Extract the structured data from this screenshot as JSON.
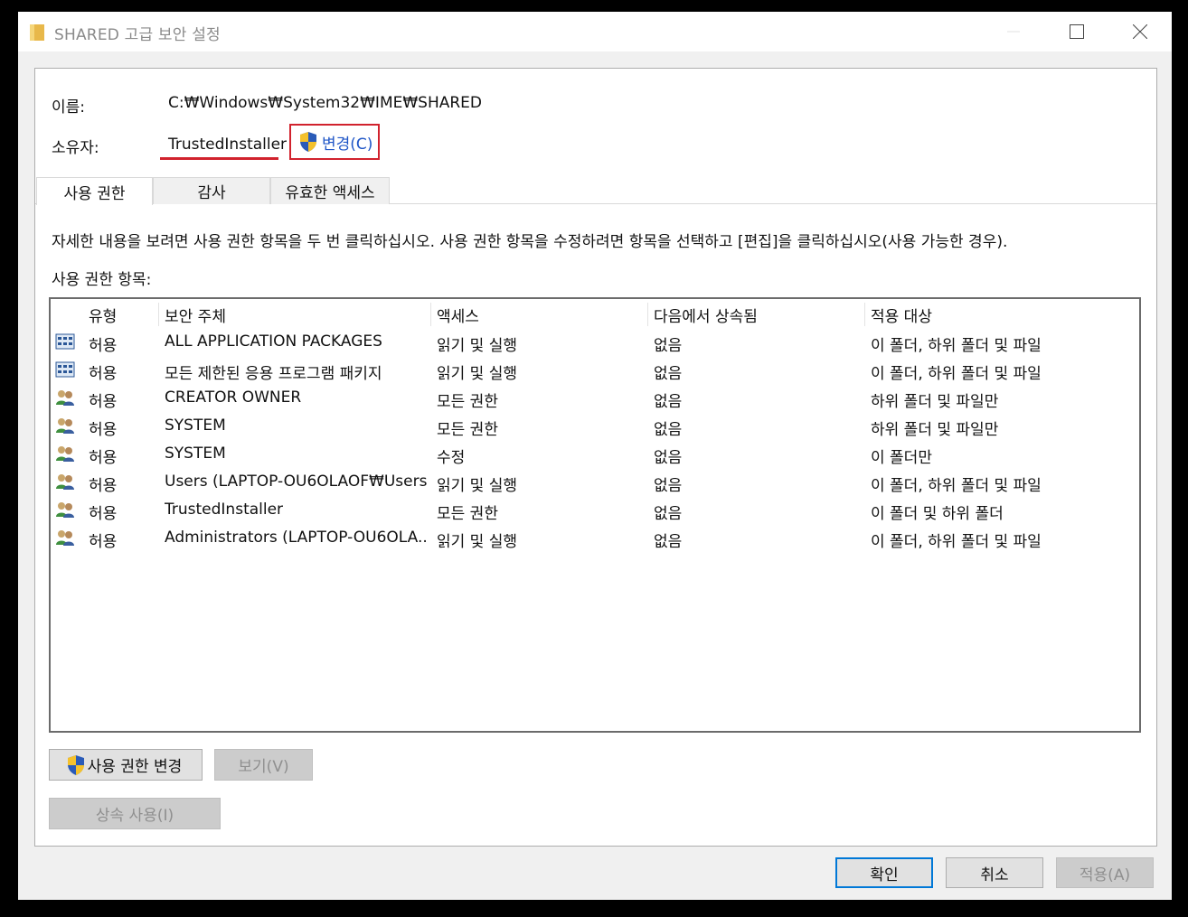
{
  "window": {
    "title": "SHARED 고급 보안 설정"
  },
  "info": {
    "name_label": "이름:",
    "name_value": "C:₩Windows₩System32₩IME₩SHARED",
    "owner_label": "소유자:",
    "owner_value": "TrustedInstaller",
    "change_label": "변경(C)"
  },
  "tabs": [
    {
      "label": "사용 권한",
      "active": true
    },
    {
      "label": "감사",
      "active": false
    },
    {
      "label": "유효한 액세스",
      "active": false
    }
  ],
  "description": "자세한 내용을 보려면 사용 권한 항목을 두 번 클릭하십시오. 사용 권한 항목을 수정하려면 항목을 선택하고 [편집]을 클릭하십시오(사용 가능한 경우).",
  "entries_label": "사용 권한 항목:",
  "table": {
    "columns": [
      "유형",
      "보안 주체",
      "액세스",
      "다음에서 상속됨",
      "적용 대상"
    ],
    "rows": [
      {
        "icon": "package-icon",
        "type": "허용",
        "principal": "ALL APPLICATION PACKAGES",
        "access": "읽기 및 실행",
        "inherited": "없음",
        "applies": "이 폴더, 하위 폴더 및 파일"
      },
      {
        "icon": "package-icon",
        "type": "허용",
        "principal": "모든 제한된 응용 프로그램 패키지",
        "access": "읽기 및 실행",
        "inherited": "없음",
        "applies": "이 폴더, 하위 폴더 및 파일"
      },
      {
        "icon": "users-icon",
        "type": "허용",
        "principal": "CREATOR OWNER",
        "access": "모든 권한",
        "inherited": "없음",
        "applies": "하위 폴더 및 파일만"
      },
      {
        "icon": "users-icon",
        "type": "허용",
        "principal": "SYSTEM",
        "access": "모든 권한",
        "inherited": "없음",
        "applies": "하위 폴더 및 파일만"
      },
      {
        "icon": "users-icon",
        "type": "허용",
        "principal": "SYSTEM",
        "access": "수정",
        "inherited": "없음",
        "applies": "이 폴더만"
      },
      {
        "icon": "users-icon",
        "type": "허용",
        "principal": "Users (LAPTOP-OU6OLAOF₩Users)",
        "access": "읽기 및 실행",
        "inherited": "없음",
        "applies": "이 폴더, 하위 폴더 및 파일"
      },
      {
        "icon": "users-icon",
        "type": "허용",
        "principal": "TrustedInstaller",
        "access": "모든 권한",
        "inherited": "없음",
        "applies": "이 폴더 및 하위 폴더"
      },
      {
        "icon": "users-icon",
        "type": "허용",
        "principal": "Administrators (LAPTOP-OU6OLA...",
        "access": "읽기 및 실행",
        "inherited": "없음",
        "applies": "이 폴더, 하위 폴더 및 파일"
      }
    ]
  },
  "buttons": {
    "change_permissions": "사용 권한 변경",
    "view": "보기(V)",
    "inheritance": "상속 사용(I)",
    "ok": "확인",
    "cancel": "취소",
    "apply": "적용(A)"
  },
  "colors": {
    "highlight_red": "#d1222d",
    "link_blue": "#1f56c7",
    "focus_blue": "#0078d7"
  }
}
